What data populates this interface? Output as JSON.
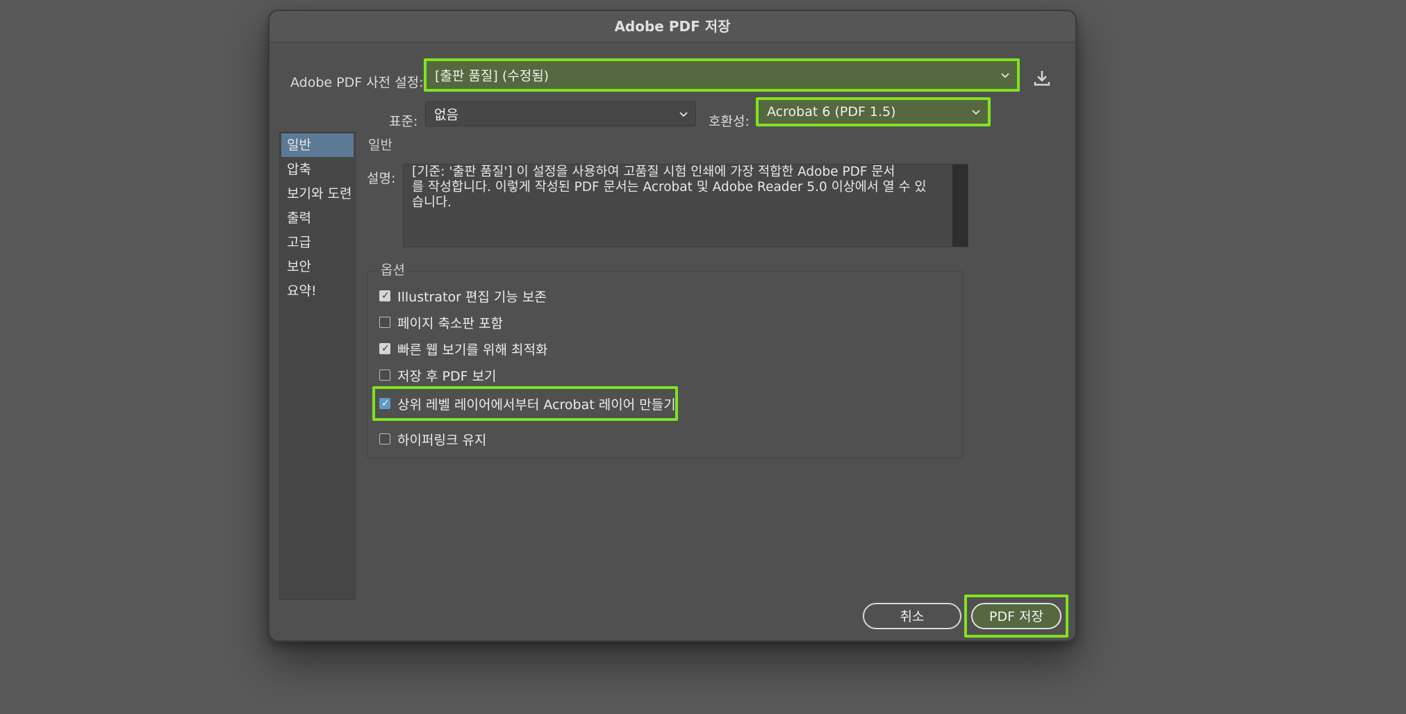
{
  "dialog": {
    "title": "Adobe PDF 저장"
  },
  "preset": {
    "label": "Adobe PDF 사전 설정:",
    "value": "[출판 품질] (수정됨)"
  },
  "standard": {
    "label": "표준:",
    "value": "없음"
  },
  "compatibility": {
    "label": "호환성:",
    "value": "Acrobat 6 (PDF 1.5)"
  },
  "sidebar": {
    "items": [
      {
        "label": "일반",
        "active": true
      },
      {
        "label": "압축",
        "active": false
      },
      {
        "label": "보기와 도련",
        "active": false
      },
      {
        "label": "출력",
        "active": false
      },
      {
        "label": "고급",
        "active": false
      },
      {
        "label": "보안",
        "active": false
      },
      {
        "label": "요약!",
        "active": false
      }
    ]
  },
  "general": {
    "section_title": "일반",
    "description_label": "설명:",
    "description_lines": [
      "[기준: '출판 품질'] 이 설정을 사용하여 고품질 시험 인쇄에 가장 적합한 Adobe PDF 문서",
      "를 작성합니다. 이렇게 작성된 PDF 문서는 Acrobat 및 Adobe Reader 5.0 이상에서 열 수 있",
      "습니다."
    ]
  },
  "options": {
    "title": "옵션",
    "items": [
      {
        "label": "Illustrator 편집 기능 보존",
        "checked": true
      },
      {
        "label": "페이지 축소판 포함",
        "checked": false
      },
      {
        "label": "빠른 웹 보기를 위해 최적화",
        "checked": true
      },
      {
        "label": "저장 후 PDF 보기",
        "checked": false
      },
      {
        "label": "상위 레벨 레이어에서부터 Acrobat 레이어 만들기",
        "checked": true
      },
      {
        "label": "하이퍼링크 유지",
        "checked": false
      }
    ]
  },
  "buttons": {
    "cancel": "취소",
    "save": "PDF 저장"
  },
  "colors": {
    "highlight": "#7ee41f",
    "selected_bg": "#56683f",
    "sidebar_active": "#5c7a96"
  }
}
